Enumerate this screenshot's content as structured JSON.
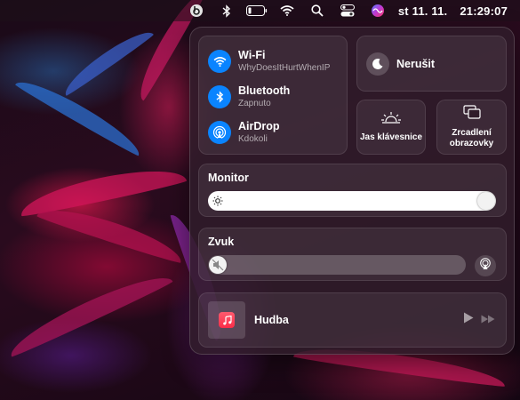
{
  "menubar": {
    "date": "st 11. 11.",
    "time": "21:29:07",
    "icons": [
      "beats-icon",
      "bluetooth-icon",
      "battery-icon",
      "wifi-icon",
      "search-icon",
      "control-center-icon",
      "siri-icon"
    ]
  },
  "control_center": {
    "network": [
      {
        "title": "Wi-Fi",
        "subtitle": "WhyDoesItHurtWhenIP",
        "icon": "wifi-icon"
      },
      {
        "title": "Bluetooth",
        "subtitle": "Zapnuto",
        "icon": "bluetooth-icon"
      },
      {
        "title": "AirDrop",
        "subtitle": "Kdokoli",
        "icon": "airdrop-icon"
      }
    ],
    "focus": {
      "label": "Nerušit",
      "icon": "moon-icon"
    },
    "keyboard_brightness": {
      "label": "Jas klávesnice",
      "icon": "keyboard-brightness-icon"
    },
    "screen_mirroring": {
      "label_line1": "Zrcadlení",
      "label_line2": "obrazovky",
      "icon": "screen-mirroring-icon"
    },
    "display": {
      "title": "Monitor",
      "level": 1.0,
      "icon": "sun-icon"
    },
    "sound": {
      "title": "Zvuk",
      "level": 0.0,
      "icon": "speaker-muted-icon"
    },
    "now_playing": {
      "label": "Hudba",
      "icon": "music-app-icon"
    },
    "colors": {
      "accent": "#0a84ff",
      "music": "#fa2d48"
    }
  }
}
